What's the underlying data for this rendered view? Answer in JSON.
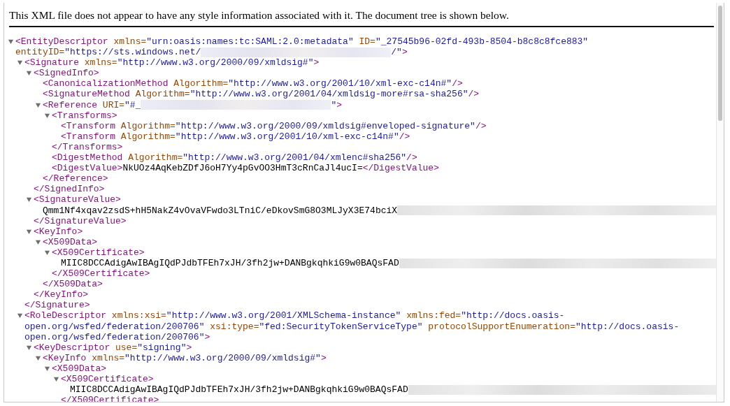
{
  "notice": "This XML file does not appear to have any style information associated with it. The document tree is shown below.",
  "tree": [
    {
      "expanded": true,
      "open": [
        {
          "kind": "tag",
          "text": "<EntityDescriptor"
        },
        {
          "kind": "attr",
          "text": " xmlns="
        },
        {
          "kind": "value",
          "text": "\"urn:oasis:names:tc:SAML:2.0:metadata\""
        },
        {
          "kind": "attr",
          "text": " ID="
        },
        {
          "kind": "value",
          "text": "\"_27545b96-02fd-493b-8504-b8c8c8fce883\""
        },
        {
          "kind": "attr",
          "text": " entityID="
        },
        {
          "kind": "value",
          "text": "\"https://sts.windows.net/"
        },
        {
          "kind": "redacted"
        },
        {
          "kind": "value",
          "text": "/\""
        },
        {
          "kind": "tag",
          "text": ">"
        }
      ],
      "children": [
        {
          "expanded": true,
          "open": [
            {
              "kind": "tag",
              "text": "<Signature"
            },
            {
              "kind": "attr",
              "text": " xmlns="
            },
            {
              "kind": "value",
              "text": "\"http://www.w3.org/2000/09/xmldsig#\""
            },
            {
              "kind": "tag",
              "text": ">"
            }
          ],
          "children": [
            {
              "expanded": true,
              "open": [
                {
                  "kind": "tag",
                  "text": "<SignedInfo>"
                }
              ],
              "children": [
                {
                  "line": [
                    {
                      "kind": "tag",
                      "text": "<CanonicalizationMethod"
                    },
                    {
                      "kind": "attr",
                      "text": " Algorithm="
                    },
                    {
                      "kind": "value",
                      "text": "\"http://www.w3.org/2001/10/xml-exc-c14n#\""
                    },
                    {
                      "kind": "tag",
                      "text": "/>"
                    }
                  ]
                },
                {
                  "line": [
                    {
                      "kind": "tag",
                      "text": "<SignatureMethod"
                    },
                    {
                      "kind": "attr",
                      "text": " Algorithm="
                    },
                    {
                      "kind": "value",
                      "text": "\"http://www.w3.org/2001/04/xmldsig-more#rsa-sha256\""
                    },
                    {
                      "kind": "tag",
                      "text": "/>"
                    }
                  ]
                },
                {
                  "expanded": true,
                  "open": [
                    {
                      "kind": "tag",
                      "text": "<Reference"
                    },
                    {
                      "kind": "attr",
                      "text": " URI="
                    },
                    {
                      "kind": "value",
                      "text": "\"#_"
                    },
                    {
                      "kind": "redacted"
                    },
                    {
                      "kind": "value",
                      "text": "\""
                    },
                    {
                      "kind": "tag",
                      "text": ">"
                    }
                  ],
                  "children": [
                    {
                      "expanded": true,
                      "open": [
                        {
                          "kind": "tag",
                          "text": "<Transforms>"
                        }
                      ],
                      "children": [
                        {
                          "line": [
                            {
                              "kind": "tag",
                              "text": "<Transform"
                            },
                            {
                              "kind": "attr",
                              "text": " Algorithm="
                            },
                            {
                              "kind": "value",
                              "text": "\"http://www.w3.org/2000/09/xmldsig#enveloped-signature\""
                            },
                            {
                              "kind": "tag",
                              "text": "/>"
                            }
                          ]
                        },
                        {
                          "line": [
                            {
                              "kind": "tag",
                              "text": "<Transform"
                            },
                            {
                              "kind": "attr",
                              "text": " Algorithm="
                            },
                            {
                              "kind": "value",
                              "text": "\"http://www.w3.org/2001/10/xml-exc-c14n#\""
                            },
                            {
                              "kind": "tag",
                              "text": "/>"
                            }
                          ]
                        }
                      ],
                      "close": [
                        {
                          "kind": "tag",
                          "text": "</Transforms>"
                        }
                      ]
                    },
                    {
                      "line": [
                        {
                          "kind": "tag",
                          "text": "<DigestMethod"
                        },
                        {
                          "kind": "attr",
                          "text": " Algorithm="
                        },
                        {
                          "kind": "value",
                          "text": "\"http://www.w3.org/2001/04/xmlenc#sha256\""
                        },
                        {
                          "kind": "tag",
                          "text": "/>"
                        }
                      ]
                    },
                    {
                      "line": [
                        {
                          "kind": "tag",
                          "text": "<DigestValue>"
                        },
                        {
                          "kind": "text",
                          "text": "NkUOz4AqKebZDfJ6oH7Yy4pGvOO3HmT3cRnCaJl4ucI="
                        },
                        {
                          "kind": "tag",
                          "text": "</DigestValue>"
                        }
                      ]
                    }
                  ],
                  "close": [
                    {
                      "kind": "tag",
                      "text": "</Reference>"
                    }
                  ]
                }
              ],
              "close": [
                {
                  "kind": "tag",
                  "text": "</SignedInfo>"
                }
              ]
            },
            {
              "expanded": true,
              "open": [
                {
                  "kind": "tag",
                  "text": "<SignatureValue>"
                }
              ],
              "children": [
                {
                  "line": [
                    {
                      "kind": "text",
                      "text": "Qmm1Nf4xqav2zsdS+hH5NakZ4vOvaVFwdo3LTniC/eDkovSmG8O3MLJyX3E74bciX"
                    },
                    {
                      "kind": "redacted"
                    }
                  ]
                }
              ],
              "close": [
                {
                  "kind": "tag",
                  "text": "</SignatureValue>"
                }
              ]
            },
            {
              "expanded": true,
              "open": [
                {
                  "kind": "tag",
                  "text": "<KeyInfo>"
                }
              ],
              "children": [
                {
                  "expanded": true,
                  "open": [
                    {
                      "kind": "tag",
                      "text": "<X509Data>"
                    }
                  ],
                  "children": [
                    {
                      "expanded": true,
                      "open": [
                        {
                          "kind": "tag",
                          "text": "<X509Certificate>"
                        }
                      ],
                      "children": [
                        {
                          "line": [
                            {
                              "kind": "text",
                              "text": "MIIC8DCCAdigAwIBAgIQdPJdbTFEh7xJH/3fh2jw+DANBgkqhkiG9w0BAQsFAD"
                            },
                            {
                              "kind": "redacted"
                            }
                          ]
                        }
                      ],
                      "close": [
                        {
                          "kind": "tag",
                          "text": "</X509Certificate>"
                        }
                      ]
                    }
                  ],
                  "close": [
                    {
                      "kind": "tag",
                      "text": "</X509Data>"
                    }
                  ]
                }
              ],
              "close": [
                {
                  "kind": "tag",
                  "text": "</KeyInfo>"
                }
              ]
            }
          ],
          "close": [
            {
              "kind": "tag",
              "text": "</Signature>"
            }
          ]
        },
        {
          "expanded": true,
          "open": [
            {
              "kind": "tag",
              "text": "<RoleDescriptor"
            },
            {
              "kind": "attr",
              "text": " xmlns:xsi="
            },
            {
              "kind": "value",
              "text": "\"http://www.w3.org/2001/XMLSchema-instance\""
            },
            {
              "kind": "attr",
              "text": " xmlns:fed="
            },
            {
              "kind": "value",
              "text": "\"http://docs.oasis-open.org/wsfed/federation/200706\""
            },
            {
              "kind": "attr",
              "text": " xsi:type="
            },
            {
              "kind": "value",
              "text": "\"fed:SecurityTokenServiceType\""
            },
            {
              "kind": "attr",
              "text": " protocolSupportEnumeration="
            },
            {
              "kind": "value",
              "text": "\"http://docs.oasis-open.org/wsfed/federation/200706\""
            },
            {
              "kind": "tag",
              "text": ">"
            }
          ],
          "children": [
            {
              "expanded": true,
              "open": [
                {
                  "kind": "tag",
                  "text": "<KeyDescriptor"
                },
                {
                  "kind": "attr",
                  "text": " use="
                },
                {
                  "kind": "value",
                  "text": "\"signing\""
                },
                {
                  "kind": "tag",
                  "text": ">"
                }
              ],
              "children": [
                {
                  "expanded": true,
                  "open": [
                    {
                      "kind": "tag",
                      "text": "<KeyInfo"
                    },
                    {
                      "kind": "attr",
                      "text": " xmlns="
                    },
                    {
                      "kind": "value",
                      "text": "\"http://www.w3.org/2000/09/xmldsig#\""
                    },
                    {
                      "kind": "tag",
                      "text": ">"
                    }
                  ],
                  "children": [
                    {
                      "expanded": true,
                      "open": [
                        {
                          "kind": "tag",
                          "text": "<X509Data>"
                        }
                      ],
                      "children": [
                        {
                          "expanded": true,
                          "open": [
                            {
                              "kind": "tag",
                              "text": "<X509Certificate>"
                            }
                          ],
                          "children": [
                            {
                              "line": [
                                {
                                  "kind": "text",
                                  "text": "MIIC8DCCAdigAwIBAgIQdPJdbTFEh7xJH/3fh2jw+DANBgkqhkiG9w0BAQsFAD"
                                },
                                {
                                  "kind": "redacted"
                                }
                              ]
                            }
                          ],
                          "close": [
                            {
                              "kind": "tag",
                              "text": "</X509Certificate>"
                            }
                          ]
                        }
                      ]
                    }
                  ]
                }
              ]
            }
          ]
        }
      ]
    }
  ]
}
